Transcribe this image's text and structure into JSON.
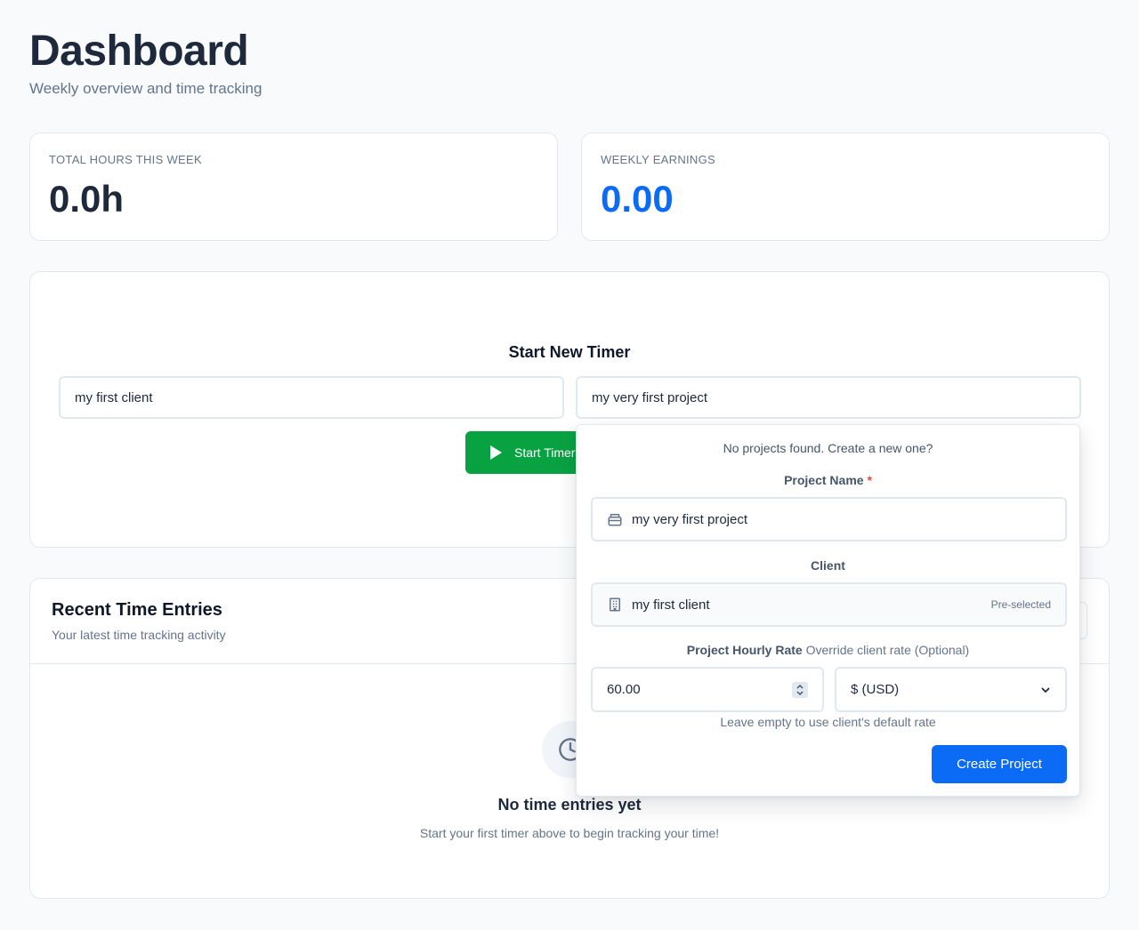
{
  "header": {
    "title": "Dashboard",
    "subtitle": "Weekly overview and time tracking"
  },
  "stats": {
    "hours_label": "TOTAL HOURS THIS WEEK",
    "hours_value": "0.0h",
    "earnings_label": "WEEKLY EARNINGS",
    "earnings_value": "0.00",
    "accent_color": "#0b6bf5"
  },
  "timer": {
    "title": "Start New Timer",
    "client_value": "my first client",
    "project_value": "my very first project",
    "start_label": "Start Timer",
    "start_color": "#09a243"
  },
  "recent": {
    "title": "Recent Time Entries",
    "subtitle": "Your latest time tracking activity",
    "empty_icon": "clock-icon",
    "empty_title": "No time entries yet",
    "empty_subtitle": "Start your first timer above to begin tracking your time!"
  },
  "dropdown": {
    "message": "No projects found. Create a new one?",
    "project_name_label": "Project Name",
    "required_mark": "*",
    "project_name_value": "my very first project",
    "project_icon": "archive-icon",
    "client_label": "Client",
    "client_value": "my first client",
    "client_icon": "building-icon",
    "client_badge": "Pre-selected",
    "rate_label": "Project Hourly Rate",
    "rate_label_note": "Override client rate (Optional)",
    "rate_value": "60.00",
    "currency_value": "$ (USD)",
    "hint": "Leave empty to use client's default rate",
    "create_label": "Create Project"
  }
}
